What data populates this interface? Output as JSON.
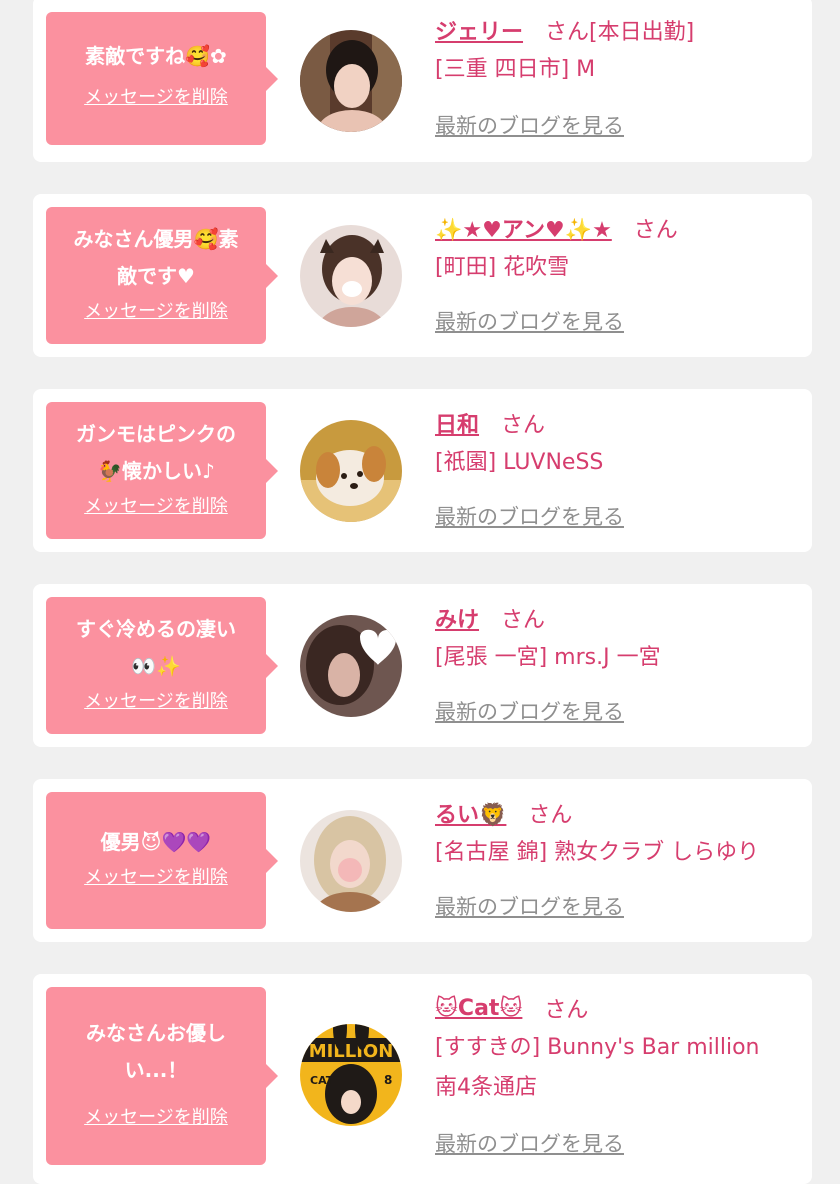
{
  "delete_label": "メッセージを削除",
  "blog_label": "最新のブログを見る",
  "san_label": "さん",
  "accent_color": "#fb919f",
  "name_color": "#d63d6e",
  "items": [
    {
      "message": "素敵ですね🥰✿",
      "name": "ジェリー",
      "suffix": "さん[本日出勤]",
      "shop": "[三重 四日市] M"
    },
    {
      "message": "みなさん優男🥰素\n敵です♥",
      "name": "✨★♥アン♥✨★",
      "suffix": "さん",
      "shop": "[町田] 花吹雪"
    },
    {
      "message": "ガンモはピンクの\n🐓懐かしい♪",
      "name": "日和",
      "suffix": "さん",
      "shop": "[祇園] LUVNeSS"
    },
    {
      "message": "すぐ冷めるの凄い\n👀✨",
      "name": "みけ",
      "suffix": "さん",
      "shop": "[尾張 一宮] mrs.J 一宮"
    },
    {
      "message": "優男😈💜💜",
      "name": "るい🦁",
      "suffix": "さん",
      "shop": "[名古屋 錦] 熟女クラブ しらゆり"
    },
    {
      "message": "みなさんお優し\nい...！",
      "name": "🐱Cat🐱",
      "suffix": "さん",
      "shop": "[すすきの] Bunny's Bar million\n南4条通店"
    }
  ]
}
